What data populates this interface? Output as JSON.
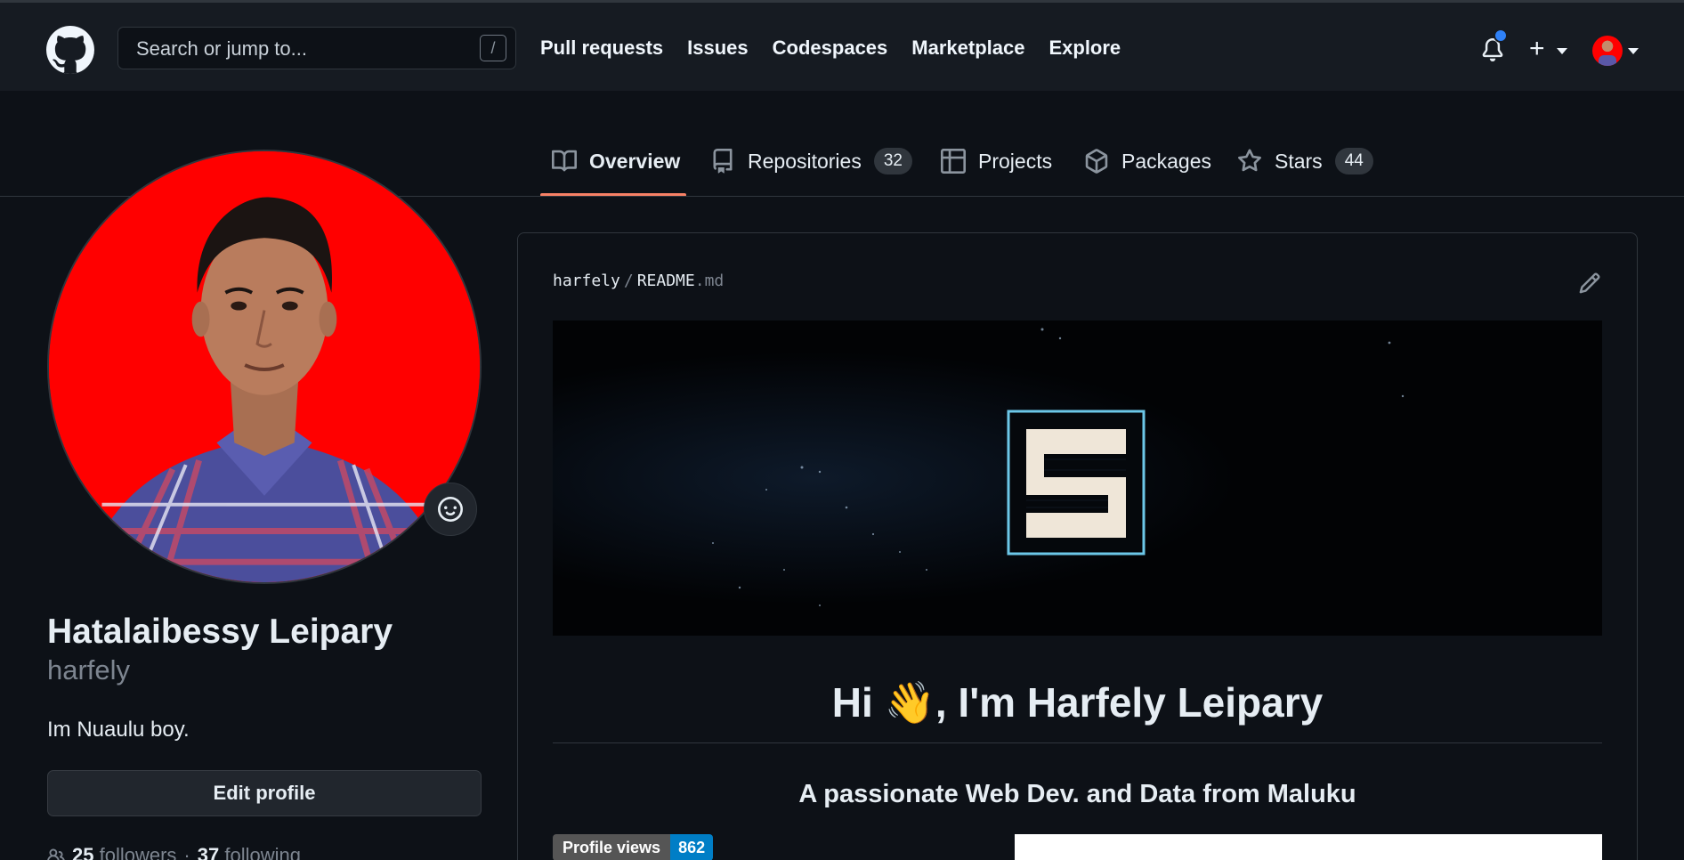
{
  "header": {
    "search_placeholder": "Search or jump to...",
    "search_shortcut": "/",
    "nav": [
      "Pull requests",
      "Issues",
      "Codespaces",
      "Marketplace",
      "Explore"
    ],
    "plus": "+"
  },
  "tabs": {
    "overview": "Overview",
    "repositories": "Repositories",
    "repositories_count": "32",
    "projects": "Projects",
    "packages": "Packages",
    "stars": "Stars",
    "stars_count": "44"
  },
  "profile": {
    "name": "Hatalaibessy Leipary",
    "login": "harfely",
    "bio": "Im Nuaulu boy.",
    "edit_button": "Edit profile",
    "followers_count": "25",
    "followers_label": "followers",
    "separator": "·",
    "following_count": "37",
    "following_label": "following"
  },
  "readme": {
    "owner": "harfely",
    "sep": "/",
    "file_name": "README",
    "file_ext": ".md",
    "heading": "Hi 👋, I'm Harfely Leipary",
    "subtitle": "A passionate Web Dev. and Data from Maluku",
    "badge_label": "Profile views",
    "badge_value": "862"
  },
  "colors": {
    "background": "#0d1117",
    "header": "#161b22",
    "accent_underline": "#f78166",
    "notification": "#2f81f7",
    "avatar_bg": "#ff0000",
    "badge_blue": "#007ec6"
  },
  "icons": [
    "github-logo-icon",
    "bell-icon",
    "plus-icon",
    "book-icon",
    "repo-icon",
    "table-icon",
    "package-icon",
    "star-icon",
    "smiley-icon",
    "pencil-icon",
    "people-icon"
  ]
}
